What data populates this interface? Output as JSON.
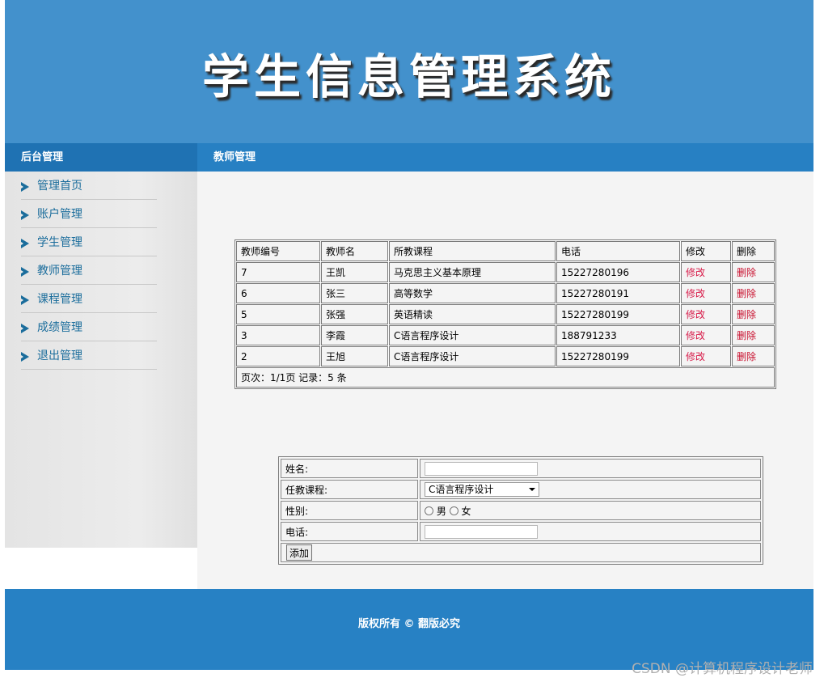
{
  "header": {
    "title": "学生信息管理系统"
  },
  "sidebar": {
    "heading": "后台管理",
    "items": [
      {
        "label": "管理首页"
      },
      {
        "label": "账户管理"
      },
      {
        "label": "学生管理"
      },
      {
        "label": "教师管理"
      },
      {
        "label": "课程管理"
      },
      {
        "label": "成绩管理"
      },
      {
        "label": "退出管理"
      }
    ]
  },
  "content": {
    "heading": "教师管理"
  },
  "table": {
    "columns": [
      "教师编号",
      "教师名",
      "所教课程",
      "电话",
      "修改",
      "删除"
    ],
    "rows": [
      {
        "id": "7",
        "name": "王凯",
        "course": "马克思主义基本原理",
        "phone": "15227280196",
        "edit": "修改",
        "delete": "删除"
      },
      {
        "id": "6",
        "name": "张三",
        "course": "高等数学",
        "phone": "15227280191",
        "edit": "修改",
        "delete": "删除"
      },
      {
        "id": "5",
        "name": "张强",
        "course": "英语精读",
        "phone": "15227280199",
        "edit": "修改",
        "delete": "删除"
      },
      {
        "id": "3",
        "name": "李霞",
        "course": "C语言程序设计",
        "phone": "188791233",
        "edit": "修改",
        "delete": "删除"
      },
      {
        "id": "2",
        "name": "王旭",
        "course": "C语言程序设计",
        "phone": "15227280199",
        "edit": "修改",
        "delete": "删除"
      }
    ],
    "pagination": "页次：1/1页 记录：5 条"
  },
  "form": {
    "name_label": "姓名:",
    "name_value": "",
    "course_label": "任教课程:",
    "course_selected": "C语言程序设计",
    "gender_label": "性别:",
    "gender_male": "男",
    "gender_female": "女",
    "phone_label": "电话:",
    "phone_value": "",
    "submit_label": "添加"
  },
  "footer": {
    "text": "版权所有 © 翻版必究"
  },
  "watermark": "CSDN @计算机程序设计老师"
}
